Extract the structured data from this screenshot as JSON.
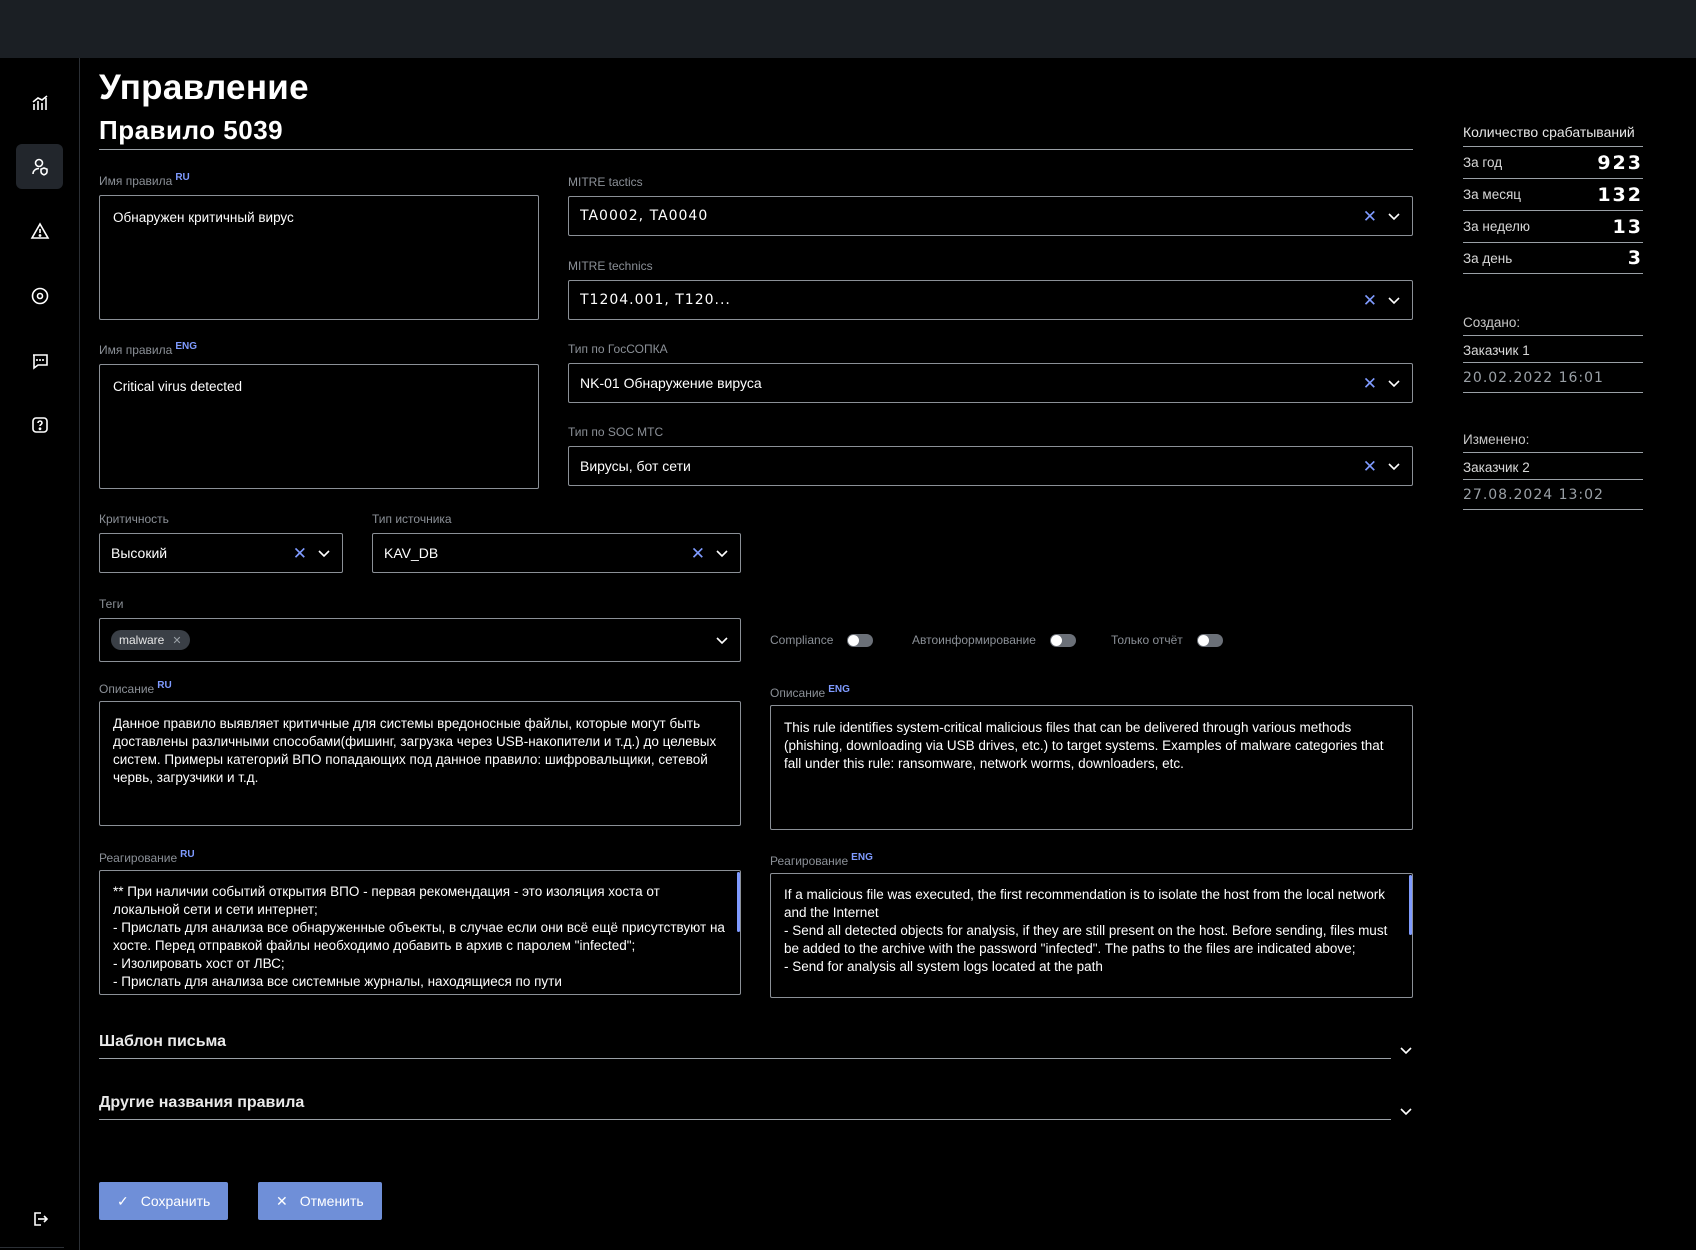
{
  "page": {
    "title": "Управление",
    "subtitle": "Правило 5039"
  },
  "sidebar": {
    "items": [
      {
        "icon": "chart-bars-icon"
      },
      {
        "icon": "user-shield-icon",
        "active": true
      },
      {
        "icon": "warning-icon"
      },
      {
        "icon": "target-icon"
      },
      {
        "icon": "chat-icon"
      },
      {
        "icon": "help-icon"
      }
    ],
    "logout_icon": "logout-icon"
  },
  "form": {
    "name_ru": {
      "label": "Имя правила",
      "lang": "RU",
      "value": "Обнаружен критичный вирус"
    },
    "name_eng": {
      "label": "Имя правила",
      "lang": "ENG",
      "value": "Critical virus detected"
    },
    "mitre_tactics": {
      "label": "MITRE tactics",
      "value": "TA0002, TA0040"
    },
    "mitre_technics": {
      "label": "MITRE technics",
      "value": "T1204.001, T120..."
    },
    "gossopka": {
      "label": "Тип по ГосСОПКА",
      "value": "NK-01 Обнаружение вируса"
    },
    "soc_mts": {
      "label": "Тип по SOC МТС",
      "value": "Вирусы, бот сети"
    },
    "criticality": {
      "label": "Критичность",
      "value": "Высокий"
    },
    "source_type": {
      "label": "Тип источника",
      "value": "KAV_DB"
    },
    "tags": {
      "label": "Теги",
      "chips": [
        "malware"
      ]
    },
    "toggles": {
      "compliance": "Compliance",
      "autoinform": "Автоинформирование",
      "report_only": "Только отчёт"
    },
    "desc_ru": {
      "label": "Описание",
      "lang": "RU",
      "value": "Данное правило выявляет критичные для системы вредоносные файлы, которые могут быть доставлены различными способами(фишинг, загрузка через USB-накопители и т.д.) до целевых систем. Примеры категорий ВПО попадающих под данное правило: шифровальщики, сетевой червь, загрузчики и т.д."
    },
    "desc_eng": {
      "label": "Описание",
      "lang": "ENG",
      "value": "This rule identifies system-critical malicious files that can be delivered through various methods (phishing, downloading via USB drives, etc.) to target systems. Examples of malware categories that fall under this rule: ransomware, network worms, downloaders, etc."
    },
    "resp_ru": {
      "label": "Реагирование",
      "lang": "RU",
      "value": "** При наличии событий открытия ВПО - первая рекомендация - это изоляция хоста от локальной сети и сети интернет;\n- Прислать для анализа все обнаруженные объекты, в случае если они всё ещё присутствуют на хосте. Перед отправкой файлы необходимо добавить в архив с паролем \"infected\";\n- Изолировать хост от ЛВС;\n- Прислать для анализа все системные журналы, находящиеся по пути"
    },
    "resp_eng": {
      "label": "Реагирование",
      "lang": "ENG",
      "value": "If a malicious file was executed, the first recommendation is to isolate the host from the local network and the Internet\n- Send all detected objects for analysis, if they are still present on the host. Before sending, files must be added to the archive with the password \"infected\". The paths to the files are indicated above;\n- Send for analysis all system logs located at the path"
    }
  },
  "accordions": {
    "mail_template": "Шаблон письма",
    "other_names": "Другие названия правила"
  },
  "buttons": {
    "save": "Сохранить",
    "cancel": "Отменить"
  },
  "stats": {
    "title": "Количество срабатываний",
    "rows": [
      {
        "label": "За год",
        "value": "923"
      },
      {
        "label": "За месяц",
        "value": "132"
      },
      {
        "label": "За неделю",
        "value": "13"
      },
      {
        "label": "За день",
        "value": "3"
      }
    ]
  },
  "created": {
    "label": "Создано:",
    "by": "Заказчик 1",
    "at": "20.02.2022 16:01"
  },
  "modified": {
    "label": "Изменено:",
    "by": "Заказчик 2",
    "at": "27.08.2024 13:02"
  },
  "colors": {
    "accent": "#7f9bff",
    "button": "#6f8fd8",
    "background": "#000000",
    "topbar": "#1b1f24"
  }
}
